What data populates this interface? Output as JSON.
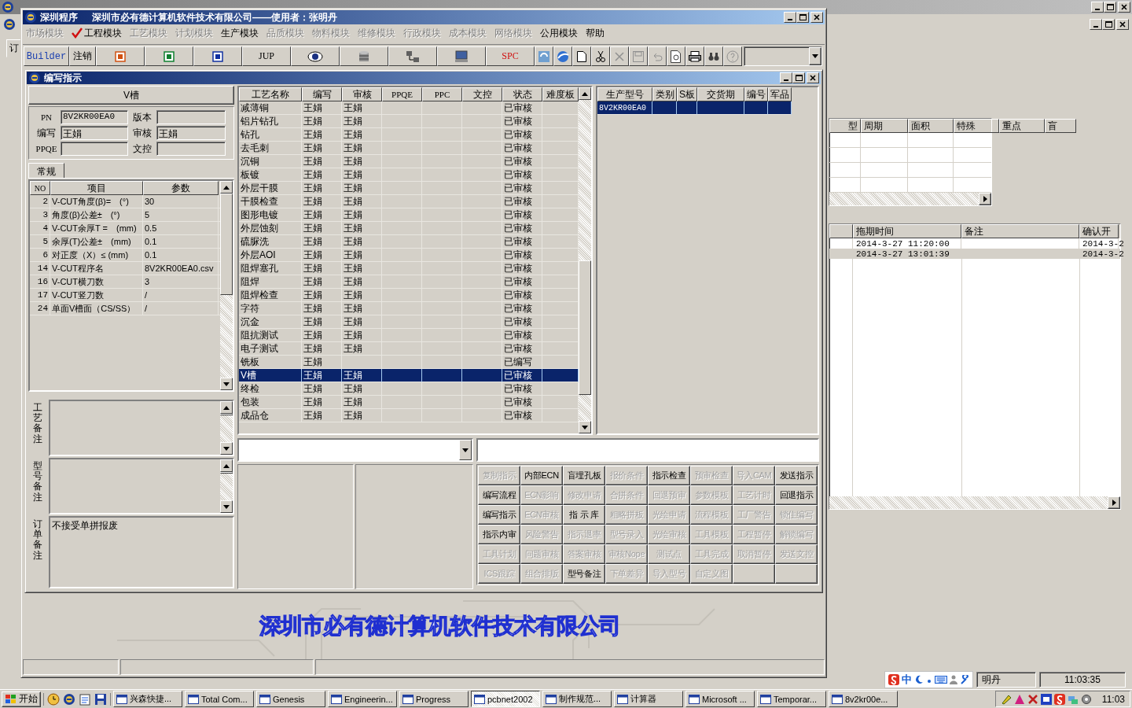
{
  "back_window": {
    "tab": "订",
    "grid_a": {
      "columns": [
        "型",
        "周期",
        "面积",
        "特殊",
        "重点",
        "盲"
      ]
    },
    "grid_b": {
      "columns": [
        "拖期时间",
        "备注",
        "确认开"
      ],
      "rows": [
        {
          "delay": "2014-3-27 11:20:00",
          "confirm": "2014-3-2",
          "selected": false
        },
        {
          "delay": "2014-3-27 13:01:39",
          "confirm": "2014-3-2",
          "selected": true
        }
      ]
    },
    "status": {
      "ime": "中",
      "user": "明丹",
      "time": "11:03:35"
    }
  },
  "main_window": {
    "app": "深圳程序",
    "title": "深圳市必有德计算机软件技术有限公司——使用者：张明丹"
  },
  "menu": [
    {
      "label": "市场模块",
      "disabled": true,
      "checked": false
    },
    {
      "label": "工程模块",
      "disabled": false,
      "checked": true
    },
    {
      "label": "工艺模块",
      "disabled": true,
      "checked": false
    },
    {
      "label": "计划模块",
      "disabled": true,
      "checked": false
    },
    {
      "label": "生产模块",
      "disabled": false,
      "checked": false
    },
    {
      "label": "品质模块",
      "disabled": true,
      "checked": false
    },
    {
      "label": "物料模块",
      "disabled": true,
      "checked": false
    },
    {
      "label": "维修模块",
      "disabled": true,
      "checked": false
    },
    {
      "label": "行政模块",
      "disabled": true,
      "checked": false
    },
    {
      "label": "成本模块",
      "disabled": true,
      "checked": false
    },
    {
      "label": "网络模块",
      "disabled": true,
      "checked": false
    },
    {
      "label": "公用模块",
      "disabled": false,
      "checked": false
    },
    {
      "label": "帮助",
      "disabled": false,
      "checked": false
    }
  ],
  "toolbar": {
    "builder": "Builder",
    "logout": "注销",
    "jup": "JUP",
    "spc": "SPC"
  },
  "child_window": {
    "title": "编写指示"
  },
  "process_header": "V槽",
  "fields": [
    {
      "label": "PN",
      "value": "8V2KR00EA0"
    },
    {
      "label": "版本"
    },
    {
      "label": "编写",
      "value": "王娟"
    },
    {
      "label": "审核",
      "value": "王娟"
    },
    {
      "label": "PPQE"
    },
    {
      "label": "文控"
    }
  ],
  "tab": "常规",
  "params": {
    "columns": [
      "NO",
      "项目",
      "参数"
    ],
    "rows": [
      [
        "2",
        "V-CUT角度(β)=　(°)",
        "30"
      ],
      [
        "3",
        "角度(β)公差±　(°)",
        "5"
      ],
      [
        "4",
        "V-CUT余厚T =　(mm)",
        "0.5"
      ],
      [
        "5",
        "余厚(T)公差±　(mm)",
        "0.1"
      ],
      [
        "6",
        "对正度（X）≤ (mm)",
        "0.1"
      ],
      [
        "14",
        "V-CUT程序名",
        "8V2KR00EA0.csv"
      ],
      [
        "16",
        "V-CUT横刀数",
        "3"
      ],
      [
        "17",
        "V-CUT竖刀数",
        "/"
      ],
      [
        "24",
        "单面V槽面（CS/SS）",
        "/"
      ]
    ]
  },
  "memos": [
    {
      "label": "工艺备注"
    },
    {
      "label": "型号备注"
    },
    {
      "label": "订单备注",
      "value": "不接受单拼报废"
    }
  ],
  "process": {
    "columns": [
      "工艺名称",
      "编写",
      "审核",
      "PPQE",
      "PPC",
      "文控",
      "状态",
      "难度板"
    ],
    "rows": [
      {
        "name": "减薄铜",
        "writer": "王娟",
        "reviewer": "王娟",
        "status": "已审核",
        "selected": false
      },
      {
        "name": "铝片钻孔",
        "writer": "王娟",
        "reviewer": "王娟",
        "status": "已审核",
        "selected": false
      },
      {
        "name": "钻孔",
        "writer": "王娟",
        "reviewer": "王娟",
        "status": "已审核",
        "selected": false
      },
      {
        "name": "去毛刺",
        "writer": "王娟",
        "reviewer": "王娟",
        "status": "已审核",
        "selected": false
      },
      {
        "name": "沉铜",
        "writer": "王娟",
        "reviewer": "王娟",
        "status": "已审核",
        "selected": false
      },
      {
        "name": "板镀",
        "writer": "王娟",
        "reviewer": "王娟",
        "status": "已审核",
        "selected": false
      },
      {
        "name": "外层干膜",
        "writer": "王娟",
        "reviewer": "王娟",
        "status": "已审核",
        "selected": false
      },
      {
        "name": "干膜检查",
        "writer": "王娟",
        "reviewer": "王娟",
        "status": "已审核",
        "selected": false
      },
      {
        "name": "图形电镀",
        "writer": "王娟",
        "reviewer": "王娟",
        "status": "已审核",
        "selected": false
      },
      {
        "name": "外层蚀刻",
        "writer": "王娟",
        "reviewer": "王娟",
        "status": "已审核",
        "selected": false
      },
      {
        "name": "硫脲洗",
        "writer": "王娟",
        "reviewer": "王娟",
        "status": "已审核",
        "selected": false
      },
      {
        "name": "外层AOI",
        "writer": "王娟",
        "reviewer": "王娟",
        "status": "已审核",
        "selected": false
      },
      {
        "name": "阻焊塞孔",
        "writer": "王娟",
        "reviewer": "王娟",
        "status": "已审核",
        "selected": false
      },
      {
        "name": "阻焊",
        "writer": "王娟",
        "reviewer": "王娟",
        "status": "已审核",
        "selected": false
      },
      {
        "name": "阻焊检查",
        "writer": "王娟",
        "reviewer": "王娟",
        "status": "已审核",
        "selected": false
      },
      {
        "name": "字符",
        "writer": "王娟",
        "reviewer": "王娟",
        "status": "已审核",
        "selected": false
      },
      {
        "name": "沉金",
        "writer": "王娟",
        "reviewer": "王娟",
        "status": "已审核",
        "selected": false
      },
      {
        "name": "阻抗测试",
        "writer": "王娟",
        "reviewer": "王娟",
        "status": "已审核",
        "selected": false
      },
      {
        "name": "电子测试",
        "writer": "王娟",
        "reviewer": "王娟",
        "status": "已审核",
        "selected": false
      },
      {
        "name": "铣板",
        "writer": "王娟",
        "status": "已编写",
        "selected": false
      },
      {
        "name": "V槽",
        "writer": "王娟",
        "reviewer": "王娟",
        "status": "已审核",
        "selected": true
      },
      {
        "name": "终检",
        "writer": "王娟",
        "reviewer": "王娟",
        "status": "已审核",
        "selected": false
      },
      {
        "name": "包装",
        "writer": "王娟",
        "reviewer": "王娟",
        "status": "已审核",
        "selected": false
      },
      {
        "name": "成品仓",
        "writer": "王娟",
        "reviewer": "王娟",
        "status": "已审核",
        "selected": false
      }
    ]
  },
  "orders": {
    "columns": [
      "生产型号",
      "类别",
      "S板",
      "交货期",
      "编号",
      "军品"
    ],
    "rows": [
      {
        "model": "8V2KR00EA0",
        "selected": true
      }
    ]
  },
  "actions": [
    {
      "label": "复制指示",
      "disabled": true
    },
    {
      "label": "内部ECN",
      "disabled": false
    },
    {
      "label": "盲埋孔板",
      "disabled": false
    },
    {
      "label": "报价条件",
      "disabled": true
    },
    {
      "label": "指示检查",
      "disabled": false
    },
    {
      "label": "预审检查",
      "disabled": true
    },
    {
      "label": "导入CAM",
      "disabled": true
    },
    {
      "label": "发送指示",
      "disabled": false
    },
    {
      "label": "编写流程",
      "disabled": false
    },
    {
      "label": "ECN影响",
      "disabled": true
    },
    {
      "label": "修改申请",
      "disabled": true
    },
    {
      "label": "合拼条件",
      "disabled": true
    },
    {
      "label": "回退预审",
      "disabled": true
    },
    {
      "label": "参数模板",
      "disabled": true
    },
    {
      "label": "工艺计时",
      "disabled": true
    },
    {
      "label": "回退指示",
      "disabled": false
    },
    {
      "label": "编写指示",
      "disabled": false
    },
    {
      "label": "ECN审核",
      "disabled": true
    },
    {
      "label": "指 示 库",
      "disabled": false
    },
    {
      "label": "粗略拼板",
      "disabled": true
    },
    {
      "label": "光绘申请",
      "disabled": true
    },
    {
      "label": "流程模板",
      "disabled": true
    },
    {
      "label": "工厂警告",
      "disabled": true
    },
    {
      "label": "锁住编写",
      "disabled": true
    },
    {
      "label": "指示内审",
      "disabled": false
    },
    {
      "label": "风险警告",
      "disabled": true
    },
    {
      "label": "指示退率",
      "disabled": true
    },
    {
      "label": "型号录入",
      "disabled": true
    },
    {
      "label": "光绘审核",
      "disabled": true
    },
    {
      "label": "工具模板",
      "disabled": true
    },
    {
      "label": "工程暂停",
      "disabled": true
    },
    {
      "label": "解锁编写",
      "disabled": true
    },
    {
      "label": "工具计划",
      "disabled": true
    },
    {
      "label": "问题审核",
      "disabled": true
    },
    {
      "label": "答案审核",
      "disabled": true
    },
    {
      "label": "审核Nope",
      "disabled": true
    },
    {
      "label": "测试点",
      "disabled": true
    },
    {
      "label": "工具完成",
      "disabled": true
    },
    {
      "label": "取消暂停",
      "disabled": true
    },
    {
      "label": "发送文控",
      "disabled": true
    },
    {
      "label": "ICS跟踪",
      "disabled": true
    },
    {
      "label": "组合排版",
      "disabled": true
    },
    {
      "label": "型号备注",
      "disabled": false
    },
    {
      "label": "下单差异",
      "disabled": true
    },
    {
      "label": "导入型号",
      "disabled": true
    },
    {
      "label": "自定义图",
      "disabled": true
    }
  ],
  "logo": "深圳市必有德计算机软件技术有限公司",
  "taskbar": {
    "start": "开始",
    "tasks": [
      {
        "label": "兴森快捷...",
        "selected": false
      },
      {
        "label": "Total Com...",
        "selected": false
      },
      {
        "label": "Genesis",
        "selected": false
      },
      {
        "label": "Engineerin...",
        "selected": false
      },
      {
        "label": "Progress",
        "selected": false
      },
      {
        "label": "pcbnet2002",
        "selected": true
      },
      {
        "label": "制作规范...",
        "selected": false
      },
      {
        "label": "计算器",
        "selected": false
      },
      {
        "label": "Microsoft ...",
        "selected": false
      },
      {
        "label": "Temporar...",
        "selected": false
      },
      {
        "label": "8v2kr00e...",
        "selected": false
      }
    ],
    "clock": "11:03"
  }
}
